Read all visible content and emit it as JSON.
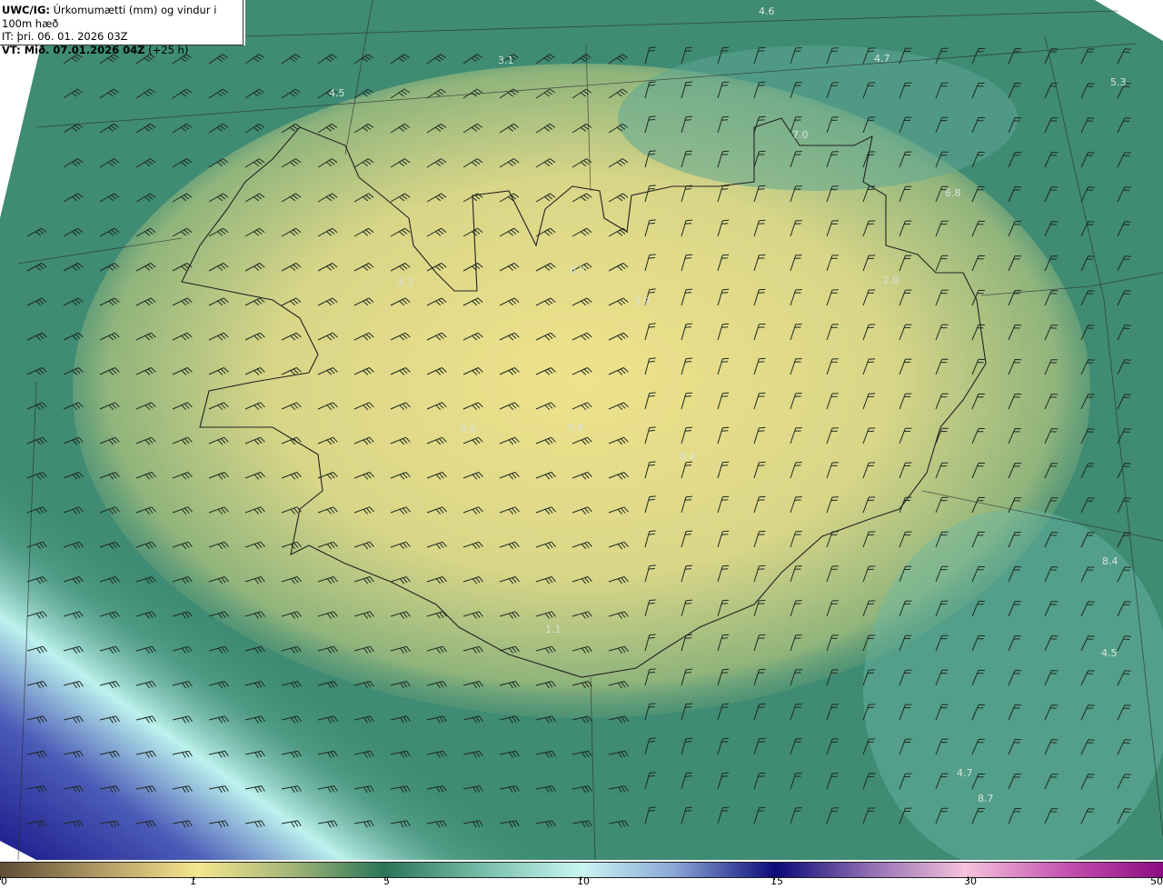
{
  "header": {
    "model": "UWC/IG:",
    "title": "Úrkomumætti (mm) og vindur i 100m hæð",
    "init_time": "IT: þri. 06. 01. 2026 03Z",
    "valid_label": "VT: Mið. 07.01.2026 04Z",
    "lead": "(+25 h)"
  },
  "map": {
    "labels": [
      "4.6",
      "3.1",
      "4.5",
      "4.7",
      "5.3",
      "7.0",
      "6.8",
      "2.0",
      "3.3",
      "0.7",
      "3.9",
      "0.6",
      "0.6",
      "0.4",
      "8.4",
      "4.5",
      "4.7",
      "8.7",
      "1.1"
    ]
  },
  "colorbar": {
    "ticks": [
      "0",
      "1",
      "5",
      "10",
      "15",
      "30",
      "50"
    ],
    "colors": [
      "#5e4d36",
      "#f4e68e",
      "#2a7558",
      "#c8f6f2",
      "#0b0a78",
      "#f6c2dc",
      "#8c0c82"
    ]
  }
}
